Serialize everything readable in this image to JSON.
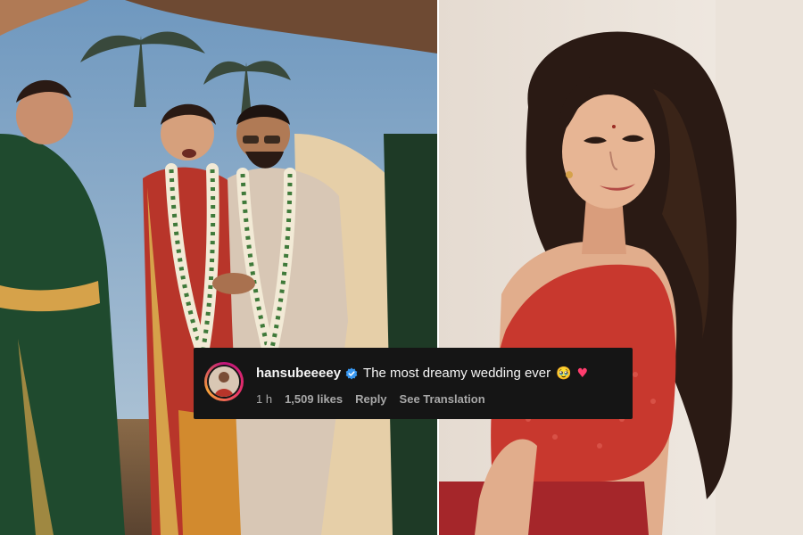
{
  "left_photo": {
    "description_icon": "wedding-photo",
    "palette": {
      "sky": "#7fa6c8",
      "green_saree": "#1f4a2e",
      "red_saree": "#b8352a",
      "suit": "#d8c7b5",
      "gold": "#d6a24a"
    }
  },
  "right_photo": {
    "description_icon": "portrait-photo",
    "palette": {
      "wall": "#eae1d8",
      "hair": "#2a1a14",
      "skin": "#e3b190",
      "top": "#c8382e"
    }
  },
  "comment": {
    "username": "hansubeeeey",
    "verified_icon": "verified-badge-icon",
    "text": "The most dreamy wedding ever",
    "emoji_face": "🥹",
    "emoji_heart": "♥",
    "time": "1 h",
    "likes": "1,509 likes",
    "reply": "Reply",
    "translation": "See Translation",
    "colors": {
      "background": "#151515",
      "text": "#f5f5f5",
      "meta": "#a8a8a8",
      "verified": "#3897f0"
    }
  }
}
